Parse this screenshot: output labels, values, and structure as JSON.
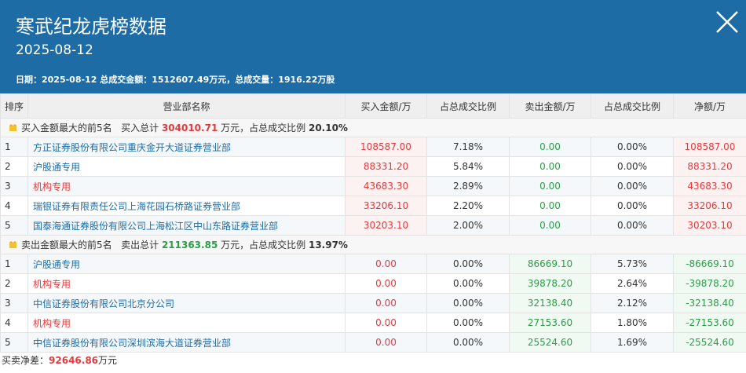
{
  "header": {
    "title": "寒武纪龙虎榜数据",
    "date": "2025-08-12",
    "summary": "日期：2025-08-12 总成交金额：1512607.49万元，总成交量：1916.22万股"
  },
  "columns": [
    "排序",
    "营业部名称",
    "买入金额/万",
    "占总成交比例",
    "卖出金额/万",
    "占总成交比例",
    "净额/万"
  ],
  "buy_section": {
    "label": "买入金额最大的前5名",
    "total_label": "买入总计",
    "total_value": "304010.71",
    "unit": "万元，占总成交比例",
    "ratio": "20.10%"
  },
  "buy_rows": [
    {
      "rank": "1",
      "name": "方正证券股份有限公司重庆金开大道证券营业部",
      "buy": "108587.00",
      "buy_pct": "7.18%",
      "sell": "0.00",
      "sell_pct": "0.00%",
      "net": "108587.00"
    },
    {
      "rank": "2",
      "name": "沪股通专用",
      "buy": "88331.20",
      "buy_pct": "5.84%",
      "sell": "0.00",
      "sell_pct": "0.00%",
      "net": "88331.20"
    },
    {
      "rank": "3",
      "name": "机构专用",
      "buy": "43683.30",
      "buy_pct": "2.89%",
      "sell": "0.00",
      "sell_pct": "0.00%",
      "net": "43683.30"
    },
    {
      "rank": "4",
      "name": "瑞银证券有限责任公司上海花园石桥路证券营业部",
      "buy": "33206.10",
      "buy_pct": "2.20%",
      "sell": "0.00",
      "sell_pct": "0.00%",
      "net": "33206.10"
    },
    {
      "rank": "5",
      "name": "国泰海通证券股份有限公司上海松江区中山东路证券营业部",
      "buy": "30203.10",
      "buy_pct": "2.00%",
      "sell": "0.00",
      "sell_pct": "0.00%",
      "net": "30203.10"
    }
  ],
  "sell_section": {
    "label": "卖出金额最大的前5名",
    "total_label": "卖出总计",
    "total_value": "211363.85",
    "unit": "万元，占总成交比例",
    "ratio": "13.97%"
  },
  "sell_rows": [
    {
      "rank": "1",
      "name": "沪股通专用",
      "buy": "0.00",
      "buy_pct": "0.00%",
      "sell": "86669.10",
      "sell_pct": "5.73%",
      "net": "-86669.10"
    },
    {
      "rank": "2",
      "name": "机构专用",
      "buy": "0.00",
      "buy_pct": "0.00%",
      "sell": "39878.20",
      "sell_pct": "2.64%",
      "net": "-39878.20"
    },
    {
      "rank": "3",
      "name": "中信证券股份有限公司北京分公司",
      "buy": "0.00",
      "buy_pct": "0.00%",
      "sell": "32138.40",
      "sell_pct": "2.12%",
      "net": "-32138.40"
    },
    {
      "rank": "4",
      "name": "机构专用",
      "buy": "0.00",
      "buy_pct": "0.00%",
      "sell": "27153.60",
      "sell_pct": "1.80%",
      "net": "-27153.60"
    },
    {
      "rank": "5",
      "name": "中信证券股份有限公司深圳滨海大道证券营业部",
      "buy": "0.00",
      "buy_pct": "0.00%",
      "sell": "25524.60",
      "sell_pct": "1.69%",
      "net": "-25524.60"
    }
  ],
  "footer": {
    "label": "买卖净差：",
    "value": "92646.86",
    "unit": "万元"
  },
  "icons": {
    "close": "close-icon",
    "section": "trophy-icon"
  },
  "colors": {
    "header_bg": "#1d6ca5",
    "positive": "#e4393c",
    "negative": "#2a9d48",
    "link": "#1d6ca5"
  }
}
